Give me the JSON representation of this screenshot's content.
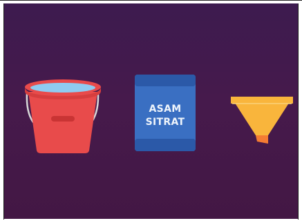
{
  "scene": {
    "package": {
      "line1": "ASAM",
      "line2": "SITRAT"
    },
    "icons": [
      "bucket-icon",
      "citric-acid-package-icon",
      "funnel-icon"
    ],
    "colors": {
      "background": "#431a4b",
      "bucket": "#e84b4b",
      "water": "#8fcbf0",
      "package": "#3a6fc2",
      "package_band": "#2b59a8",
      "funnel": "#f9b53c",
      "funnel_spout": "#f47c33"
    }
  }
}
